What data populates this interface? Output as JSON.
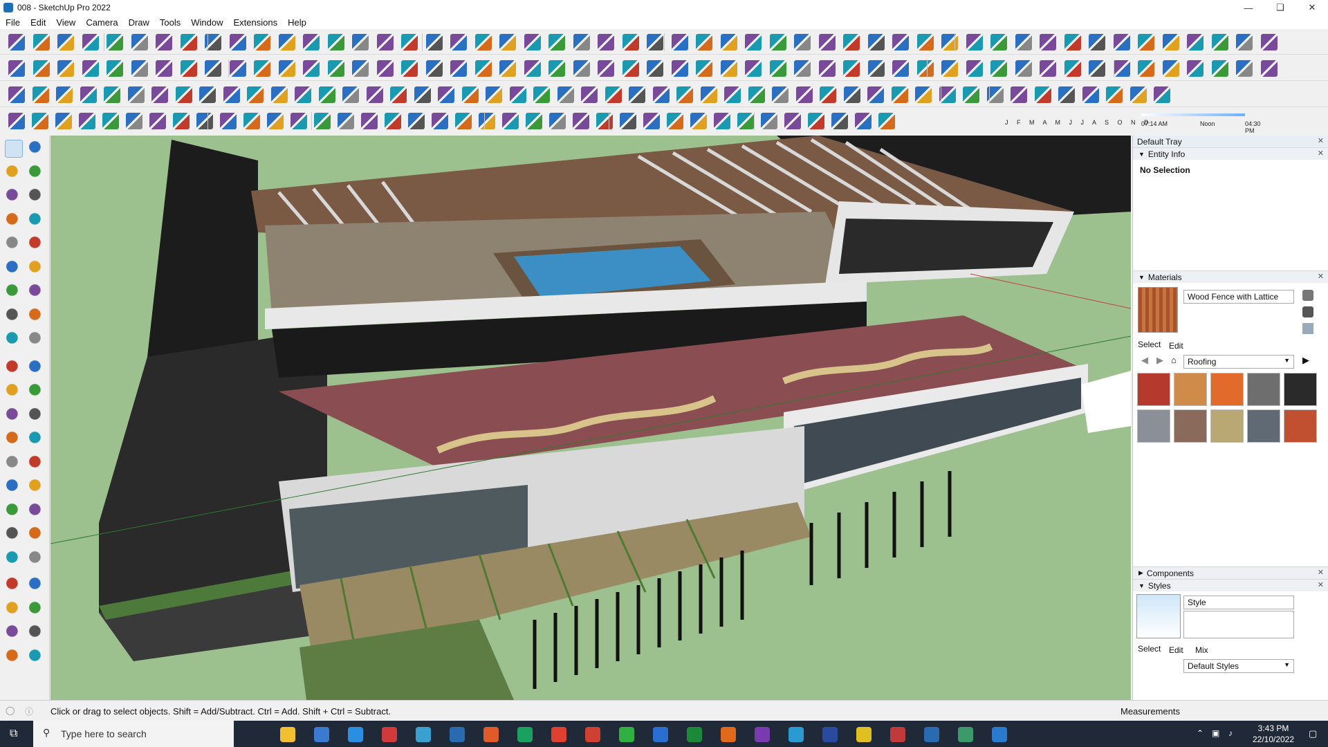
{
  "window": {
    "title": "008 - SketchUp Pro 2022"
  },
  "menu": [
    "File",
    "Edit",
    "View",
    "Camera",
    "Draw",
    "Tools",
    "Window",
    "Extensions",
    "Help"
  ],
  "shadow": {
    "months": "J F M A M J J A S O N D",
    "start": "07:14 AM",
    "noon": "Noon",
    "end": "04:30 PM"
  },
  "tray": {
    "title": "Default Tray",
    "entity_info": {
      "header": "Entity Info",
      "value": "No Selection"
    },
    "materials": {
      "header": "Materials",
      "name": "Wood Fence with Lattice",
      "tab_select": "Select",
      "tab_edit": "Edit",
      "library": "Roofing",
      "swatches": [
        "#b5392d",
        "#d08a4a",
        "#e26a2a",
        "#6e6e6e",
        "#2a2a2a",
        "#8a8f98",
        "#8a6a5a",
        "#b9a774",
        "#5f6a75",
        "#c05030"
      ]
    },
    "components": {
      "header": "Components"
    },
    "styles": {
      "header": "Styles",
      "name": "Style",
      "tab_select": "Select",
      "tab_edit": "Edit",
      "tab_mix": "Mix",
      "library": "Default Styles"
    }
  },
  "status": {
    "hint": "Click or drag to select objects. Shift = Add/Subtract. Ctrl = Add. Shift + Ctrl = Subtract.",
    "measurements": "Measurements"
  },
  "taskbar": {
    "search_placeholder": "Type here to search",
    "time": "3:43 PM",
    "date": "22/10/2022"
  }
}
